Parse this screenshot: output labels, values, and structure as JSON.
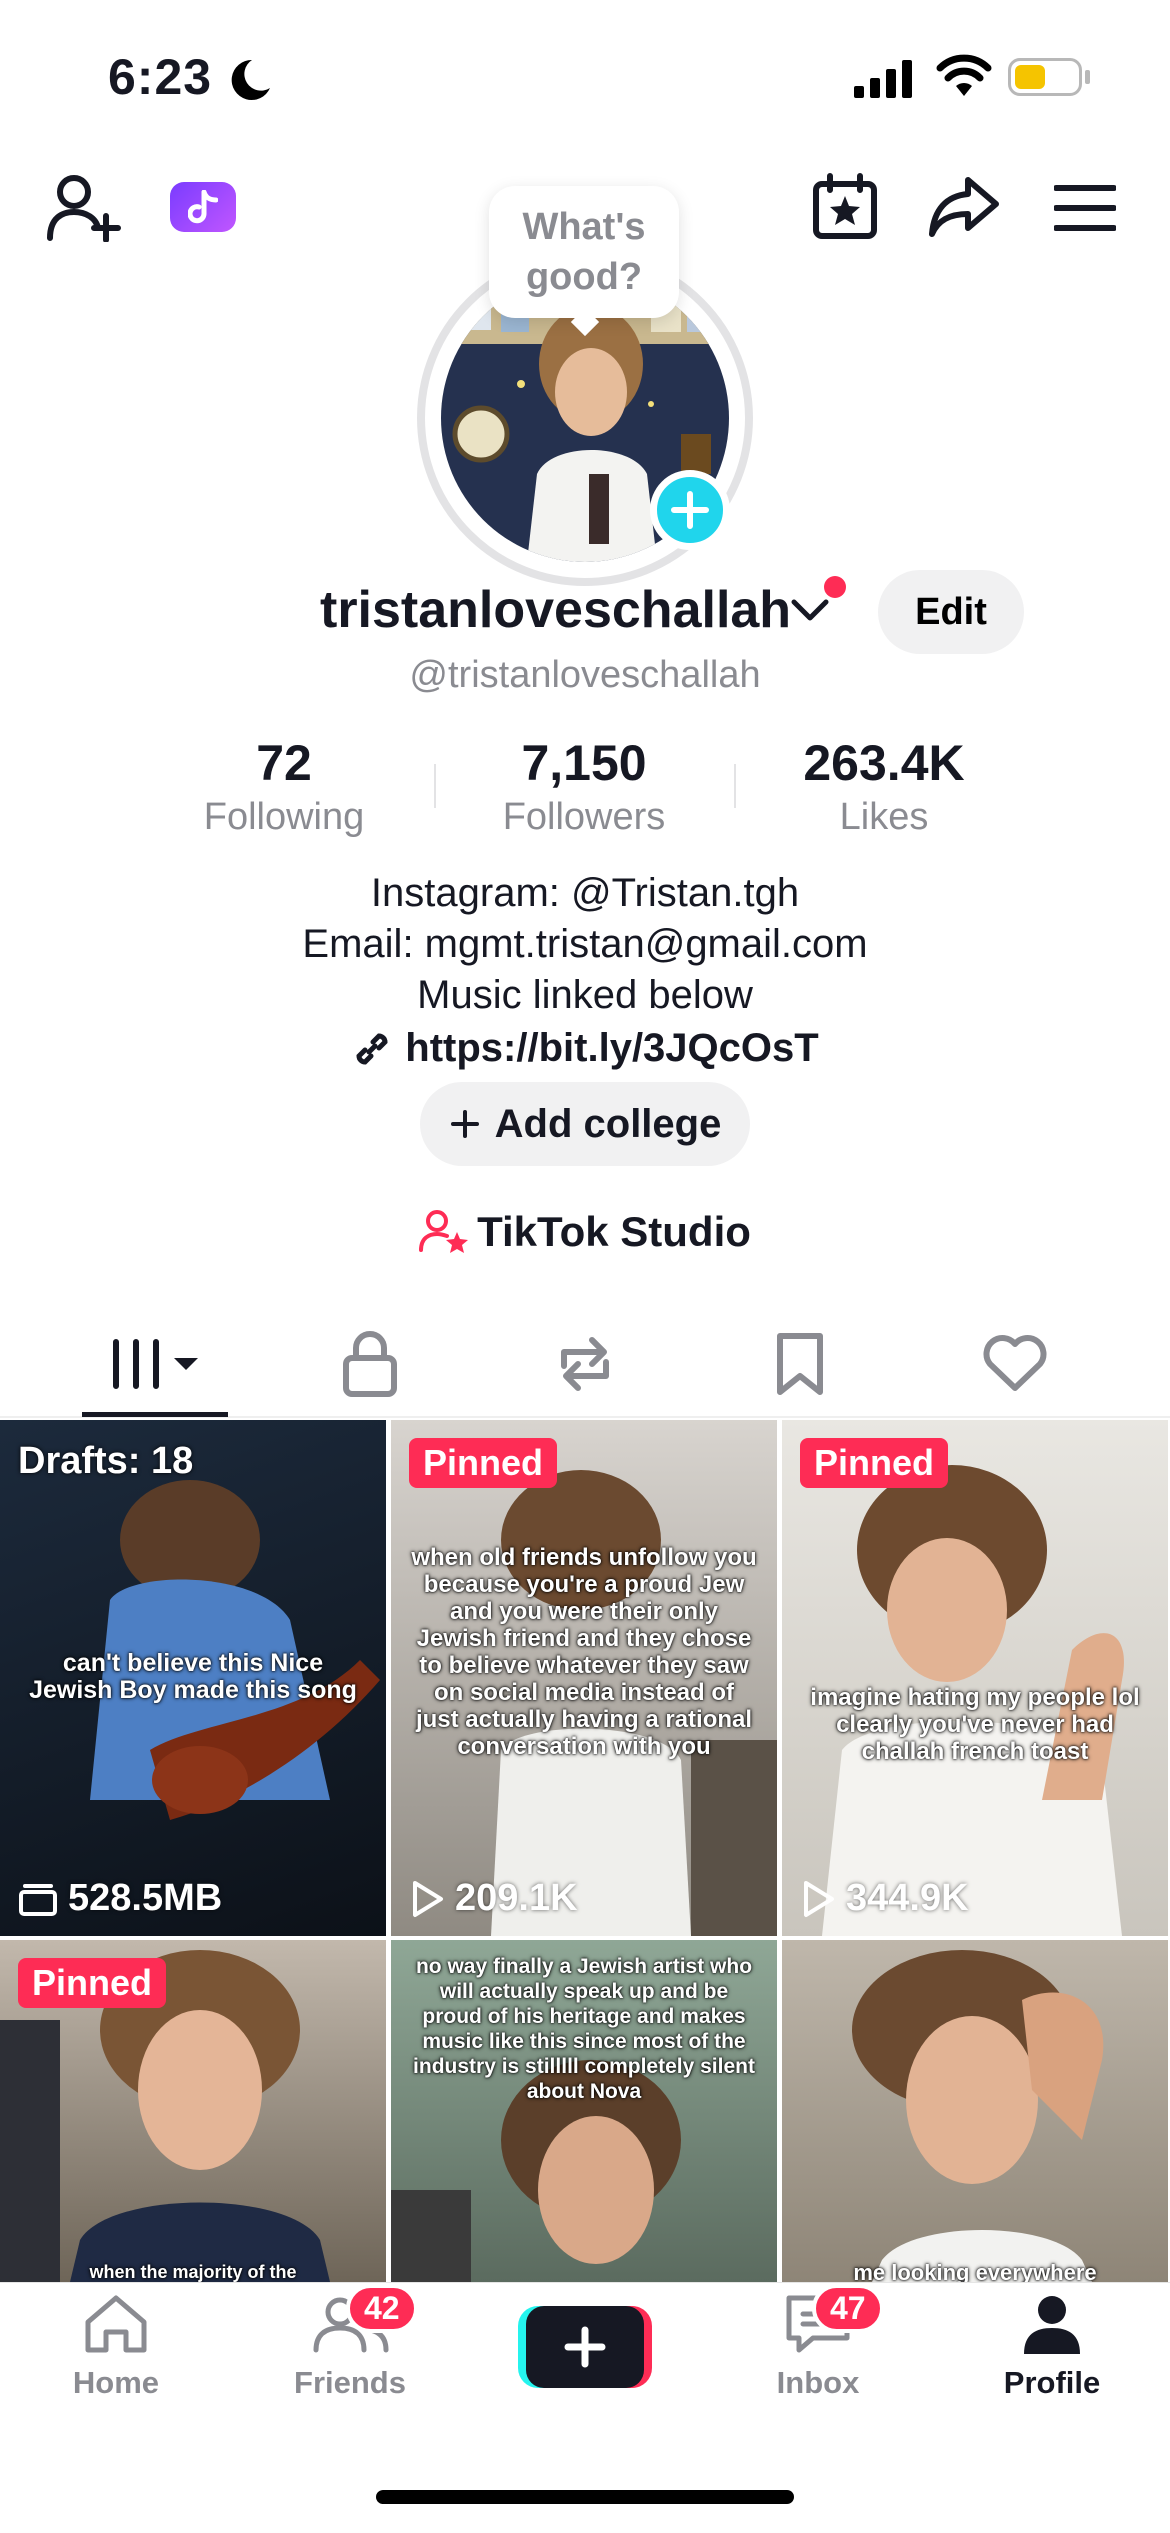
{
  "status_bar": {
    "time": "6:23"
  },
  "profile": {
    "bubble_text_1": "What's",
    "bubble_text_2": "good?",
    "username": "tristanloveschallah",
    "edit_label": "Edit",
    "handle": "@tristanloveschallah",
    "stats": [
      {
        "value": "72",
        "label": "Following"
      },
      {
        "value": "7,150",
        "label": "Followers"
      },
      {
        "value": "263.4K",
        "label": "Likes"
      }
    ],
    "bio": [
      "Instagram: @Tristan.tgh",
      "Email: mgmt.tristan@gmail.com",
      "Music linked below"
    ],
    "link": "https://bit.ly/3JQcOsT",
    "add_college": "Add college",
    "studio": "TikTok Studio"
  },
  "tiles": [
    {
      "badge": "Drafts: 18",
      "caption": "can't believe this Nice Jewish Boy made this song",
      "stat": "528.5MB"
    },
    {
      "badge": "Pinned",
      "caption": "when old friends unfollow you because you're a proud Jew and you were their only Jewish friend and they chose to believe whatever they saw on social media instead of just actually having a rational conversation with you",
      "stat": "209.1K"
    },
    {
      "badge": "Pinned",
      "caption": "imagine hating my people lol clearly you've never had challah french toast",
      "stat": "344.9K"
    },
    {
      "badge": "Pinned",
      "caption": "when the majority of the",
      "stat": ""
    },
    {
      "badge": "",
      "caption": "no way finally a Jewish artist who will actually speak up and be proud of his heritage and makes music like this since most of the industry is stilllll completely silent about Nova",
      "stat": ""
    },
    {
      "badge": "",
      "caption": "me looking everywhere",
      "stat": ""
    }
  ],
  "bottom_nav": {
    "home": "Home",
    "friends": "Friends",
    "friends_badge": "42",
    "inbox": "Inbox",
    "inbox_badge": "47",
    "profile": "Profile"
  },
  "colors": {
    "accent": "#fe2c55",
    "cyan": "#20d5ec",
    "battery": "#f5c400"
  }
}
